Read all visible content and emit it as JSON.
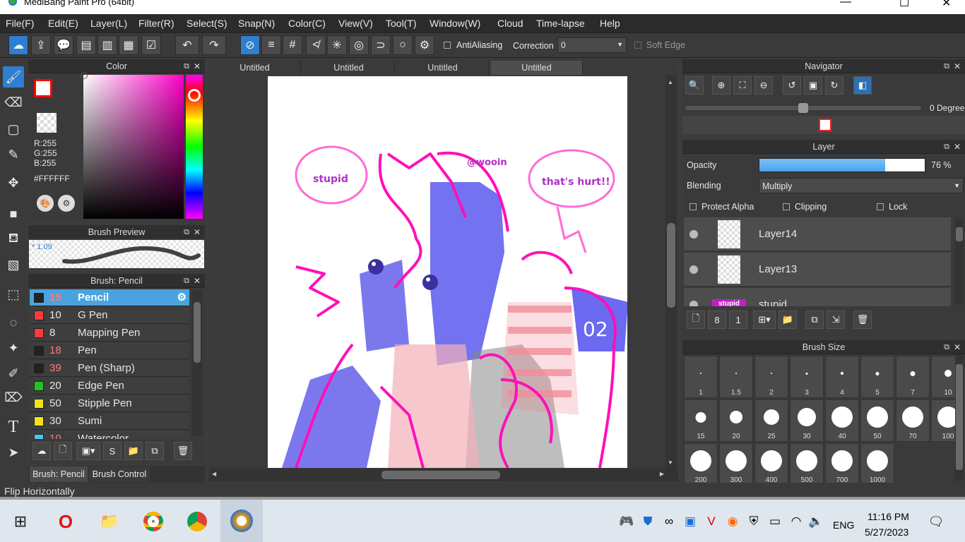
{
  "window": {
    "title": "MediBang Paint Pro (64bit)"
  },
  "menu": [
    "File(F)",
    "Edit(E)",
    "Layer(L)",
    "Filter(R)",
    "Select(S)",
    "Snap(N)",
    "Color(C)",
    "View(V)",
    "Tool(T)",
    "Window(W)",
    "Cloud",
    "Time-lapse",
    "Help"
  ],
  "toolbar": {
    "antialias_label": "AntiAliasing",
    "correction_label": "Correction",
    "correction_value": "0",
    "soft_edge_label": "Soft Edge"
  },
  "color_panel": {
    "title": "Color",
    "r": "R:255",
    "g": "G:255",
    "b": "B:255",
    "hex": "#FFFFFF",
    "primary": "#ff0000",
    "secondary": "#ffffff"
  },
  "brush_preview": {
    "title": "Brush Preview",
    "size": "* 1.09"
  },
  "brush_panel": {
    "title": "Brush: Pencil",
    "items": [
      {
        "num": "15",
        "name": "Pencil",
        "color": "#222222",
        "num_color": "#ff6b6b"
      },
      {
        "num": "10",
        "name": "G Pen",
        "color": "#ff3b3b",
        "num_color": "#e6e6e6"
      },
      {
        "num": "8",
        "name": "Mapping Pen",
        "color": "#ff3b3b",
        "num_color": "#e6e6e6"
      },
      {
        "num": "18",
        "name": "Pen",
        "color": "#222222",
        "num_color": "#ff6b6b"
      },
      {
        "num": "39",
        "name": "Pen (Sharp)",
        "color": "#222222",
        "num_color": "#ff6b6b"
      },
      {
        "num": "20",
        "name": "Edge Pen",
        "color": "#22c322",
        "num_color": "#e6e6e6"
      },
      {
        "num": "50",
        "name": "Stipple Pen",
        "color": "#f2e21c",
        "num_color": "#e6e6e6"
      },
      {
        "num": "30",
        "name": "Sumi",
        "color": "#f2e21c",
        "num_color": "#e6e6e6"
      },
      {
        "num": "10",
        "name": "Watercolor",
        "color": "#4fc3f7",
        "num_color": "#ff6b6b"
      }
    ],
    "tab_active": "Brush: Pencil",
    "tab_other": "Brush Control"
  },
  "tabs": [
    "Untitled",
    "Untitled",
    "Untitled",
    "Untitled"
  ],
  "artwork": {
    "bubble_left": "stupid",
    "bubble_right": "that's hurt!!",
    "signature": "@wooin",
    "sign_text": "02"
  },
  "navigator": {
    "title": "Navigator",
    "angle": "0 Degree"
  },
  "layer_panel": {
    "title": "Layer",
    "opacity_label": "Opacity",
    "opacity_value": "76 %",
    "opacity_level": 0.76,
    "blending_label": "Blending",
    "blending_value": "Multiply",
    "protect_alpha": "Protect Alpha",
    "clipping": "Clipping",
    "lock": "Lock",
    "layers": [
      "Layer14",
      "Layer13",
      "stupid"
    ],
    "thumb_text": "stupid"
  },
  "brush_size": {
    "title": "Brush Size",
    "sizes": [
      "1",
      "1.5",
      "2",
      "3",
      "4",
      "5",
      "7",
      "10",
      "15",
      "20",
      "25",
      "30",
      "40",
      "50",
      "70",
      "100",
      "200",
      "300",
      "400",
      "500",
      "700",
      "1000"
    ]
  },
  "status": {
    "text": "Flip Horizontally"
  },
  "taskbar": {
    "lang": "ENG",
    "time": "11:16 PM",
    "date": "5/27/2023"
  }
}
